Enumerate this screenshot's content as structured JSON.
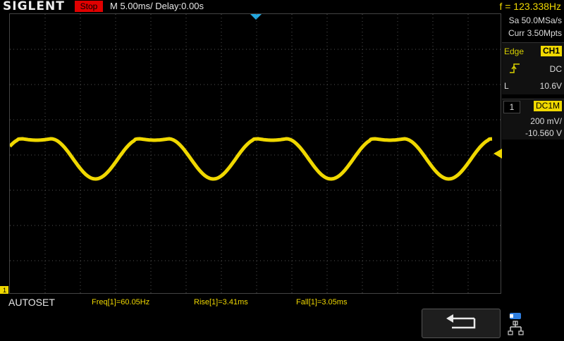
{
  "header": {
    "logo": "SIGLENT",
    "run_state": "Stop",
    "timebase": "M 5.00ms/ Delay:0.00s",
    "frequency": "f = 123.338Hz"
  },
  "acquisition": {
    "sample_rate": "Sa 50.0MSa/s",
    "memory": "Curr 3.50Mpts"
  },
  "trigger": {
    "type_label": "Edge",
    "source": "CH1",
    "slope_icon": "rising-edge-icon",
    "coupling": "DC",
    "level_label": "L",
    "level_value": "10.6V"
  },
  "channel": {
    "number": "1",
    "coupling_impedance": "DC1M",
    "scale": "200 mV/",
    "offset": "-10.560 V",
    "color": "#f0d800",
    "marker": "1"
  },
  "bottom": {
    "autoset": "AUTOSET",
    "measurements": [
      {
        "text": "Freq[1]=60.05Hz"
      },
      {
        "text": "Rise[1]=3.41ms"
      },
      {
        "text": "Fall[1]=3.05ms"
      }
    ]
  },
  "icons": {
    "back": "return-arrow-icon",
    "network": "network-icon"
  },
  "colors": {
    "trace": "#f0d800",
    "stop_badge": "#e00000",
    "trigger_marker": "#22a8e0"
  }
}
